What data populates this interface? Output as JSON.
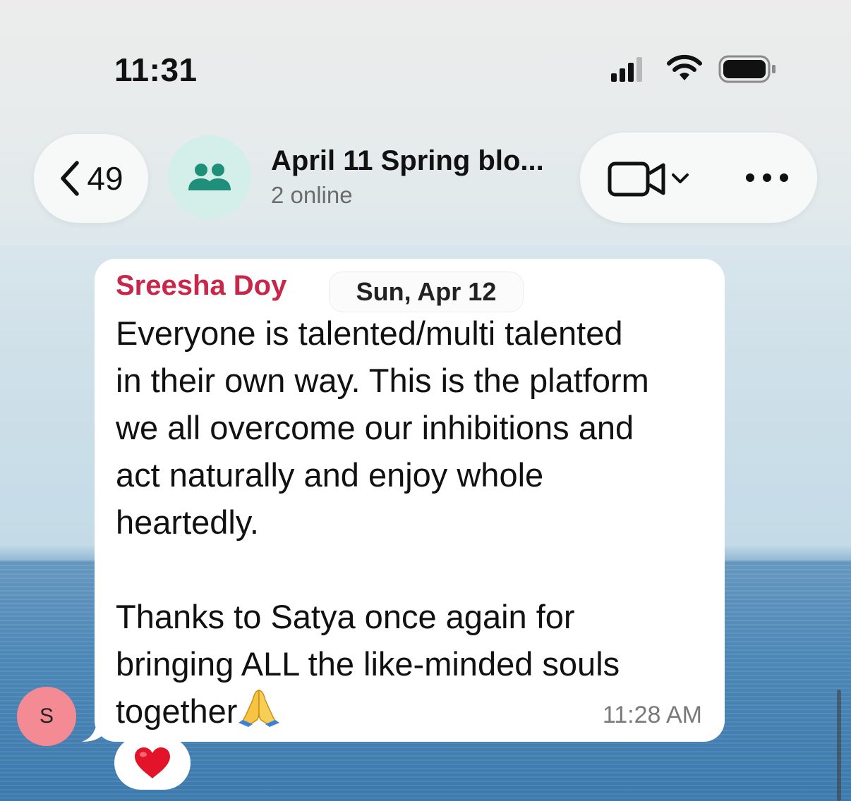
{
  "status_bar": {
    "time": "11:31"
  },
  "nav": {
    "back_count": "49",
    "title": "April 11 Spring blo...",
    "subtitle": "2 online"
  },
  "message": {
    "sender": "Sreesha Doy",
    "date": "Sun, Apr 12",
    "paragraph1": [
      "Everyone is talented/multi talented",
      "in their own way. This is the platform",
      "we all overcome our inhibitions and",
      "act naturally and enjoy whole",
      "heartedly."
    ],
    "paragraph2": [
      "Thanks to Satya once again for",
      "bringing ALL the like-minded souls",
      "together"
    ],
    "time": "11:28 AM",
    "reaction_icon": "red-heart",
    "emoji_icon": "folded-hands"
  },
  "avatar": {
    "initial": "S",
    "color": "#f48b94"
  },
  "colors": {
    "sender": "#c8274a",
    "group_avatar_bg": "#d4efe9",
    "group_icon": "#1f8f7a"
  }
}
